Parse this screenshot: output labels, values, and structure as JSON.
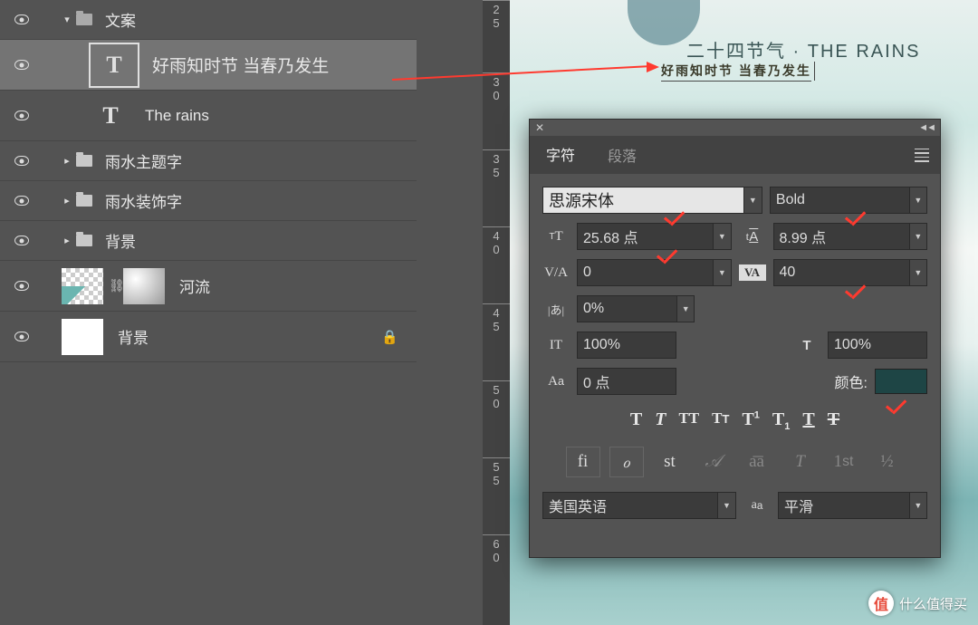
{
  "layers": {
    "group_copy": "文案",
    "text_layer_1": "好雨知时节 当春乃发生",
    "text_layer_2": "The rains",
    "group_theme": "雨水主题字",
    "group_deco": "雨水装饰字",
    "group_bg": "背景",
    "layer_river": "河流",
    "layer_bg": "背景"
  },
  "ruler": {
    "t0": "2",
    "t1": "5",
    "t2": "3",
    "t3": "0",
    "t4": "3",
    "t5": "5",
    "t6": "4",
    "t7": "0",
    "t8": "4",
    "t9": "5",
    "t10": "5",
    "t11": "0",
    "t12": "5",
    "t13": "5",
    "t14": "6",
    "t15": "0"
  },
  "canvas": {
    "subtitle": "二十四节气 · THE RAINS",
    "editing_text": "好雨知时节 当春乃发生"
  },
  "char_panel": {
    "tab_char": "字符",
    "tab_para": "段落",
    "font_family": "思源宋体",
    "font_style": "Bold",
    "font_size": "25.68 点",
    "leading": "8.99 点",
    "kerning": "0",
    "tracking": "40",
    "tsume": "0%",
    "vscale": "100%",
    "hscale": "100%",
    "baseline": "0 点",
    "color_label": "颜色:",
    "language": "美国英语",
    "aa": "平滑"
  },
  "watermark": {
    "badge": "值",
    "text": "什么值得买"
  }
}
